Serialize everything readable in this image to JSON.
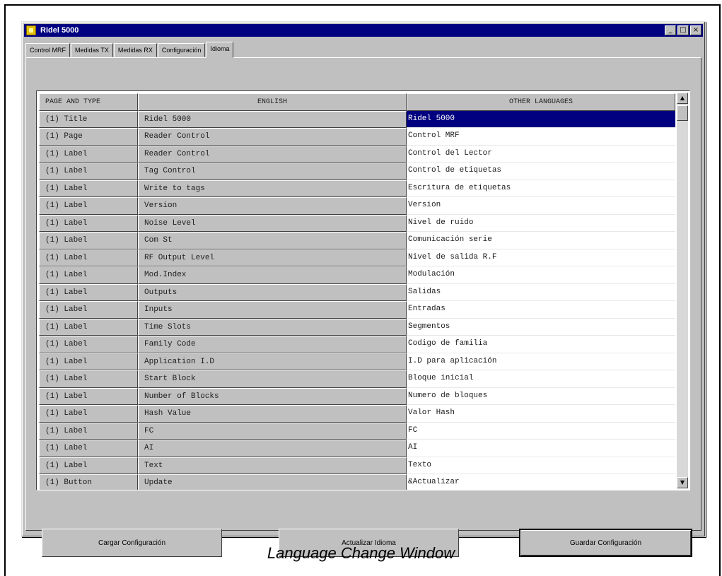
{
  "window": {
    "title": "Ridel 5000",
    "controls": [
      "_",
      "□",
      "×"
    ]
  },
  "tabs": [
    {
      "label": "Control MRF",
      "active": false
    },
    {
      "label": "Medidas TX",
      "active": false
    },
    {
      "label": "Medidas RX",
      "active": false
    },
    {
      "label": "Configuración",
      "active": false
    },
    {
      "label": "Idioma",
      "active": true
    }
  ],
  "grid": {
    "headers": [
      "PAGE AND TYPE",
      "ENGLISH",
      "OTHER LANGUAGES"
    ],
    "rows": [
      [
        "(1) Title",
        "Ridel 5000",
        "Ridel 5000"
      ],
      [
        "(1) Page",
        "Reader Control",
        "Control MRF"
      ],
      [
        "(1) Label",
        "Reader Control",
        "Control del Lector"
      ],
      [
        "(1) Label",
        "Tag Control",
        "Control de etiquetas"
      ],
      [
        "(1) Label",
        "Write to tags",
        "Escritura de etiquetas"
      ],
      [
        "(1) Label",
        "Version",
        " Version"
      ],
      [
        "(1) Label",
        "Noise Level",
        " Nivel de ruido"
      ],
      [
        "(1) Label",
        "Com St",
        " Comunicación serie"
      ],
      [
        "(1) Label",
        "RF Output Level",
        " Nivel de salida R.F"
      ],
      [
        "(1) Label",
        "Mod.Index",
        " Modulación"
      ],
      [
        "(1) Label",
        "Outputs",
        " Salidas"
      ],
      [
        "(1) Label",
        "Inputs",
        " Entradas"
      ],
      [
        "(1) Label",
        "Time Slots",
        " Segmentos"
      ],
      [
        "(1) Label",
        "Family Code",
        " Codigo de familia"
      ],
      [
        "(1) Label",
        "Application I.D",
        " I.D  para aplicación"
      ],
      [
        "(1) Label",
        "Start Block",
        " Bloque inicial"
      ],
      [
        "(1) Label",
        "Number of Blocks",
        " Numero de bloques"
      ],
      [
        "(1) Label",
        "Hash Value",
        " Valor Hash"
      ],
      [
        "(1) Label",
        "FC",
        " FC"
      ],
      [
        "(1) Label",
        "AI",
        " AI"
      ],
      [
        "(1) Label",
        "Text",
        "Texto"
      ],
      [
        "(1) Button",
        "Update",
        "&Actualizar"
      ]
    ],
    "selected_row": 0
  },
  "buttons": {
    "load": "Cargar Configuración",
    "update": "Actualizar Idioma",
    "save": "Guardar Configuración"
  },
  "caption": "Language Change Window",
  "colors": {
    "titlebar": "#000080",
    "face": "#c0c0c0",
    "selection": "#000080"
  }
}
